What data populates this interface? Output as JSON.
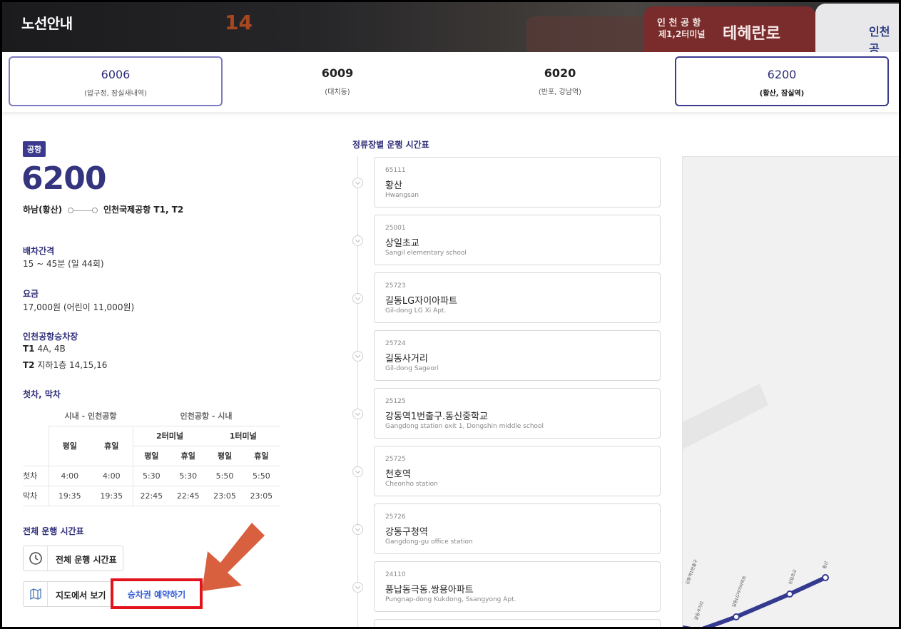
{
  "header": {
    "title": "노선안내",
    "bg_number": "14",
    "bus_text_1": "인 천 공 항",
    "bus_text_2": "제1,2터미널",
    "bus_text_3": "테헤란로",
    "bus_text_4": "인천공"
  },
  "tabs": [
    {
      "number": "6006",
      "sub": "(압구정, 잠실새내역)"
    },
    {
      "number": "6009",
      "sub": "(대치동)"
    },
    {
      "number": "6020",
      "sub": "(반포, 강남역)"
    },
    {
      "number": "6200",
      "sub": "(황산, 잠실역)"
    }
  ],
  "route": {
    "badge": "공항",
    "number": "6200",
    "from": "하남(황산)",
    "to": "인천국제공항 T1, T2",
    "interval_label": "배차간격",
    "interval_value": "15 ~ 45분 (일 44회)",
    "fare_label": "요금",
    "fare_value": "17,000원 (어린이 11,000원)",
    "stop_label": "인천공항승차장",
    "t1_label": "T1",
    "t1_value": "4A, 4B",
    "t2_label": "T2",
    "t2_value": "지하1층 14,15,16",
    "firstlast_label": "첫차, 막차"
  },
  "timetable": {
    "group1": "시내 - 인천공항",
    "group2": "인천공항 - 시내",
    "terminal2": "2터미널",
    "terminal1": "1터미널",
    "weekday": "평일",
    "holiday": "휴일",
    "rows": [
      {
        "label": "첫차",
        "values": [
          "4:00",
          "4:00",
          "5:30",
          "5:30",
          "5:50",
          "5:50"
        ]
      },
      {
        "label": "막차",
        "values": [
          "19:35",
          "19:35",
          "22:45",
          "22:45",
          "23:05",
          "23:05"
        ]
      }
    ]
  },
  "full_timetable": {
    "label": "전체 운행 시간표",
    "button": "전체 운행 시간표",
    "map_button": "지도에서 보기",
    "book_button": "승차권 예약하기"
  },
  "stops_title": "정류장별 운행 시간표",
  "stops": [
    {
      "id": "65111",
      "ko": "황산",
      "en": "Hwangsan"
    },
    {
      "id": "25001",
      "ko": "상일초교",
      "en": "Sangil elementary school"
    },
    {
      "id": "25723",
      "ko": "길동LG자이아파트",
      "en": "Gil-dong LG Xi Apt."
    },
    {
      "id": "25724",
      "ko": "길동사거리",
      "en": "Gil-dong Sageori"
    },
    {
      "id": "25125",
      "ko": "강동역1번출구.동신중학교",
      "en": "Gangdong station exit 1, Dongshin middle school"
    },
    {
      "id": "25725",
      "ko": "천호역",
      "en": "Cheonho station"
    },
    {
      "id": "25726",
      "ko": "강동구청역",
      "en": "Gangdong-gu office station"
    },
    {
      "id": "24110",
      "ko": "풍납동극동.쌍용아파트",
      "en": "Pungnap-dong Kukdong, Ssangyong Apt."
    }
  ],
  "map": {
    "labels": [
      "황산",
      "상일초교",
      "길동LG자이아파트",
      "길동사거리",
      "강동역1번출구"
    ],
    "colors": {
      "route_line": "#333a8f",
      "accent": "#3b3a8f",
      "highlight_box": "#e3131e",
      "arrow": "#d9603e"
    }
  }
}
